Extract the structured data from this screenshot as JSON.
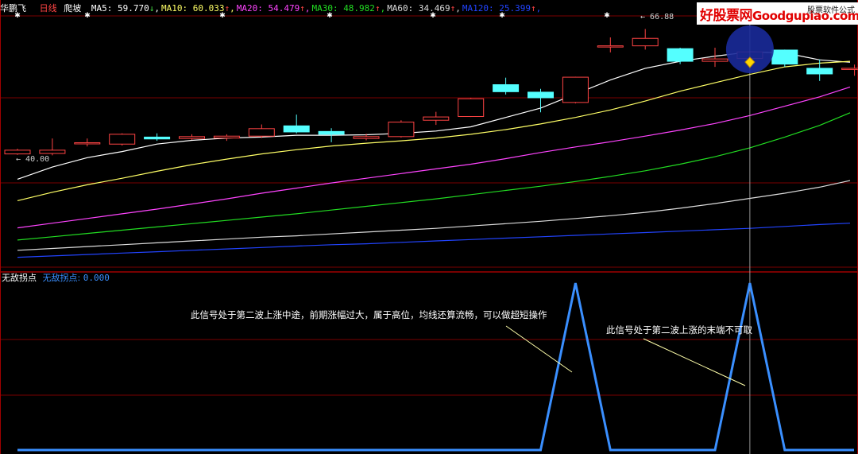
{
  "header": {
    "stock_name": "华鹏飞",
    "period": "日线",
    "formula_name": "爬坡",
    "ma": [
      {
        "label": "MA5:",
        "value": "59.770",
        "arrow": "↓",
        "color": "#ffffff"
      },
      {
        "label": "MA10:",
        "value": "60.033",
        "arrow": "↑",
        "color": "#ffff66"
      },
      {
        "label": "MA20:",
        "value": "54.479",
        "arrow": "↑",
        "color": "#ff44ff"
      },
      {
        "label": "MA30:",
        "value": "48.982",
        "arrow": "↑",
        "color": "#22dd22"
      },
      {
        "label": "MA60:",
        "value": "34.469",
        "arrow": "↑",
        "color": "#dcdcdc"
      },
      {
        "label": "MA120:",
        "value": "25.399",
        "arrow": "↑",
        "color": "#2244ff"
      }
    ]
  },
  "logo": {
    "main": "好股票网",
    "site": "Goodgupiao.com",
    "sub": "股票软件公式"
  },
  "indicator": {
    "name": "无敌拐点",
    "value_label": "无敌拐点:",
    "value": "0.000",
    "annotations": [
      "此信号处于第二波上涨中途，前期涨幅过大，属于高位，均线还算流畅，可以做超短操作",
      "此信号处于第二波上涨的末端不可取"
    ]
  },
  "colors": {
    "up": "#ff4444",
    "down": "#54ffff",
    "grid": "#7a0000",
    "signal": "#3a8fff",
    "highlight_circle": "#1a2a9a",
    "diamond": "#ffd700"
  },
  "chart_data": {
    "type": "candlestick",
    "price_labels": {
      "high": "66.88",
      "low": "40.00"
    },
    "candles": [
      {
        "o": 40.2,
        "c": 41.0,
        "h": 41.3,
        "l": 40.0
      },
      {
        "o": 40.3,
        "c": 41.0,
        "h": 43.5,
        "l": 39.9
      },
      {
        "o": 42.4,
        "c": 42.6,
        "h": 43.5,
        "l": 41.8
      },
      {
        "o": 42.3,
        "c": 44.4,
        "h": 44.6,
        "l": 42.0
      },
      {
        "o": 43.8,
        "c": 43.4,
        "h": 44.6,
        "l": 43.0
      },
      {
        "o": 43.5,
        "c": 43.9,
        "h": 44.4,
        "l": 43.2
      },
      {
        "o": 43.6,
        "c": 44.0,
        "h": 44.4,
        "l": 43.0
      },
      {
        "o": 44.0,
        "c": 45.6,
        "h": 46.5,
        "l": 43.6
      },
      {
        "o": 46.2,
        "c": 44.9,
        "h": 48.6,
        "l": 44.6
      },
      {
        "o": 45.0,
        "c": 44.4,
        "h": 45.7,
        "l": 42.7
      },
      {
        "o": 43.5,
        "c": 43.9,
        "h": 44.5,
        "l": 43.1
      },
      {
        "o": 43.9,
        "c": 47.0,
        "h": 47.4,
        "l": 43.7
      },
      {
        "o": 47.4,
        "c": 48.1,
        "h": 49.2,
        "l": 46.4
      },
      {
        "o": 48.2,
        "c": 52.0,
        "h": 52.2,
        "l": 48.1
      },
      {
        "o": 55.0,
        "c": 53.5,
        "h": 56.5,
        "l": 52.9
      },
      {
        "o": 53.4,
        "c": 52.2,
        "h": 54.1,
        "l": 49.1
      },
      {
        "o": 51.2,
        "c": 56.6,
        "h": 56.7,
        "l": 51.0
      },
      {
        "o": 63.2,
        "c": 63.3,
        "h": 65.1,
        "l": 61.9
      },
      {
        "o": 63.3,
        "c": 64.9,
        "h": 66.9,
        "l": 62.5
      },
      {
        "o": 62.7,
        "c": 60.0,
        "h": 62.9,
        "l": 59.4
      },
      {
        "o": 60.0,
        "c": 60.5,
        "h": 62.9,
        "l": 58.8
      },
      {
        "o": 60.6,
        "c": 62.0,
        "h": 62.2,
        "l": 58.8
      },
      {
        "o": 62.4,
        "c": 59.4,
        "h": 62.5,
        "l": 58.8
      },
      {
        "o": 58.5,
        "c": 57.3,
        "h": 60.4,
        "l": 55.8
      },
      {
        "o": 58.3,
        "c": 58.5,
        "h": 59.3,
        "l": 56.9
      }
    ],
    "ma_series": [
      {
        "name": "MA5",
        "color": "#ffffff",
        "values": [
          34.8,
          37.4,
          39.4,
          40.7,
          42.3,
          43.1,
          43.6,
          43.8,
          44.2,
          44.2,
          44.3,
          44.6,
          45.1,
          46.0,
          48.0,
          50.0,
          53.0,
          56.0,
          58.5,
          60.0,
          61.1,
          62.0,
          61.8,
          60.3,
          59.8
        ]
      },
      {
        "name": "MA10",
        "color": "#ffff66",
        "values": [
          30.2,
          32.0,
          33.6,
          35.0,
          36.5,
          37.9,
          39.1,
          40.2,
          41.1,
          41.9,
          42.5,
          43.0,
          43.6,
          44.4,
          45.4,
          46.6,
          48.0,
          49.6,
          51.5,
          53.6,
          55.4,
          57.2,
          58.8,
          59.6,
          60.0
        ]
      },
      {
        "name": "MA20",
        "color": "#ff44ff",
        "values": [
          24.4,
          25.4,
          26.4,
          27.4,
          28.4,
          29.5,
          30.6,
          31.8,
          32.9,
          34.0,
          35.0,
          36.0,
          37.0,
          38.0,
          39.2,
          40.5,
          41.7,
          42.8,
          44.0,
          45.3,
          46.7,
          48.4,
          50.4,
          52.4,
          54.5
        ]
      },
      {
        "name": "MA30",
        "color": "#22dd22",
        "values": [
          21.8,
          22.5,
          23.2,
          23.9,
          24.6,
          25.3,
          26.0,
          26.7,
          27.4,
          28.2,
          29.0,
          29.8,
          30.6,
          31.5,
          32.4,
          33.3,
          34.3,
          35.4,
          36.6,
          38.0,
          39.6,
          41.5,
          43.8,
          46.3,
          49.0
        ]
      },
      {
        "name": "MA60",
        "color": "#dcdcdc",
        "values": [
          19.6,
          20.0,
          20.4,
          20.8,
          21.2,
          21.6,
          22.0,
          22.4,
          22.7,
          23.1,
          23.5,
          23.9,
          24.3,
          24.8,
          25.3,
          25.8,
          26.4,
          27.0,
          27.7,
          28.6,
          29.6,
          30.7,
          31.8,
          33.1,
          34.5
        ]
      },
      {
        "name": "MA120",
        "color": "#2244ff",
        "values": [
          18.1,
          18.4,
          18.7,
          19.0,
          19.3,
          19.6,
          19.9,
          20.2,
          20.5,
          20.8,
          21.0,
          21.3,
          21.6,
          21.9,
          22.2,
          22.5,
          22.8,
          23.1,
          23.4,
          23.7,
          24.0,
          24.3,
          24.7,
          25.1,
          25.4
        ]
      }
    ],
    "signal": {
      "name": "无敌拐点",
      "values": [
        0,
        0,
        0,
        0,
        0,
        0,
        0,
        0,
        0,
        0,
        0,
        0,
        0,
        0,
        0,
        0,
        1,
        0,
        0,
        0,
        0,
        1,
        0,
        0,
        0
      ]
    },
    "highlight_index": 21
  }
}
